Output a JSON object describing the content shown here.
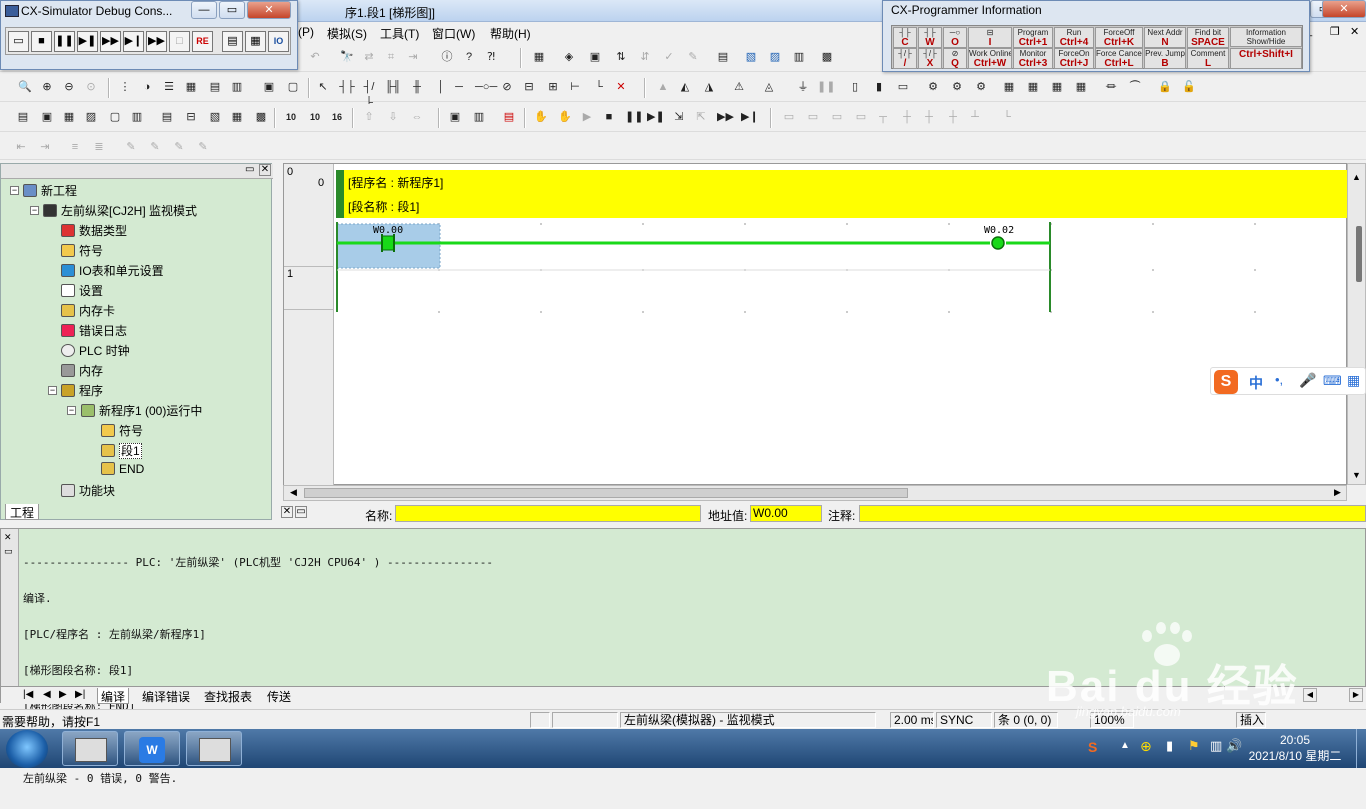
{
  "title_bar": {
    "text": "序1.段1 [梯形图]]"
  },
  "menu": {
    "items": [
      "(P)",
      "模拟(S)",
      "工具(T)",
      "窗口(W)",
      "帮助(H)"
    ]
  },
  "simulator": {
    "title": "CX-Simulator Debug Cons...",
    "buttons": [
      "▭",
      "■",
      "❚❚",
      "▶❚",
      "▶▶",
      "▶❙",
      "▶▶",
      "□",
      "RE",
      "▤",
      "▦",
      "IO"
    ]
  },
  "info_window": {
    "title": "CX-Programmer Information",
    "cells": [
      {
        "cap": "",
        "key": "C"
      },
      {
        "cap": "",
        "key": "W"
      },
      {
        "cap": "",
        "key": "O"
      },
      {
        "cap": "",
        "key": "I"
      },
      {
        "cap": "Program",
        "key": "Ctrl+1"
      },
      {
        "cap": "Run",
        "key": "Ctrl+4"
      },
      {
        "cap": "ForceOff",
        "key": "Ctrl+K"
      },
      {
        "cap": "Next Addr",
        "key": "N"
      },
      {
        "cap": "Find bit",
        "key": "SPACE"
      },
      {
        "cap": "Information",
        "key": "Show/Hide"
      },
      {
        "cap": "",
        "key": "/"
      },
      {
        "cap": "",
        "key": "X"
      },
      {
        "cap": "",
        "key": "Q"
      },
      {
        "cap": "Work Online",
        "key": "Ctrl+W"
      },
      {
        "cap": "Monitor",
        "key": "Ctrl+3"
      },
      {
        "cap": "ForceOn",
        "key": "Ctrl+J"
      },
      {
        "cap": "Force Cancel",
        "key": "Ctrl+L"
      },
      {
        "cap": "Prev. Jump",
        "key": "B"
      },
      {
        "cap": "Comment",
        "key": "L"
      },
      {
        "cap": "",
        "key": "Ctrl+Shift+I"
      }
    ]
  },
  "tree": {
    "items": [
      {
        "label": "新工程",
        "level": 0
      },
      {
        "label": "左前纵梁[CJ2H] 监视模式",
        "level": 1
      },
      {
        "label": "数据类型",
        "level": 2
      },
      {
        "label": "符号",
        "level": 2
      },
      {
        "label": "IO表和单元设置",
        "level": 2
      },
      {
        "label": "设置",
        "level": 2
      },
      {
        "label": "内存卡",
        "level": 2
      },
      {
        "label": "错误日志",
        "level": 2
      },
      {
        "label": "PLC 时钟",
        "level": 2
      },
      {
        "label": "内存",
        "level": 2
      },
      {
        "label": "程序",
        "level": 2
      },
      {
        "label": "新程序1 (00)运行中",
        "level": 3
      },
      {
        "label": "符号",
        "level": 4
      },
      {
        "label": "段1",
        "level": 4
      },
      {
        "label": "END",
        "level": 4
      },
      {
        "label": "功能块",
        "level": 2
      }
    ],
    "tab": "工程"
  },
  "ladder": {
    "row0_num": "0",
    "step0": "0",
    "program_name": "[程序名 : 新程序1]",
    "section_name": "[段名称 : 段1]",
    "contact_addr": "W0.00",
    "coil_addr": "W0.02",
    "row1_num": "1"
  },
  "infobar": {
    "name_label": "名称:",
    "addr_label": "地址值:",
    "addr_value": "W0.00",
    "comment_label": "注释:"
  },
  "output": {
    "lines": [
      "---------------- PLC: '左前纵梁' (PLC机型 'CJ2H CPU64' ) ----------------",
      "编译.",
      "[PLC/程序名 : 左前纵梁/新程序1]",
      "[梯形图段名称: 段1]",
      "[梯形图段名称: END]",
      "",
      "左前纵梁 - 0 错误, 0 警告."
    ],
    "tabs": [
      "编译",
      "编译错误",
      "查找报表",
      "传送"
    ]
  },
  "status": {
    "help": "需要帮助，请按F1",
    "plc_mode": "左前纵梁(模拟器) - 监视模式",
    "cycle": "2.00 ms",
    "sync": "SYNC",
    "position": "条 0 (0, 0)",
    "zoom": "100%",
    "last": "插入"
  },
  "taskbar": {
    "time": "20:05",
    "date": "2021/8/10 星期二"
  },
  "ime": {
    "lang": "中",
    "punct": "•,"
  },
  "watermark": {
    "text": "Bai du 经验",
    "url": "jingyan.baidu.com"
  }
}
